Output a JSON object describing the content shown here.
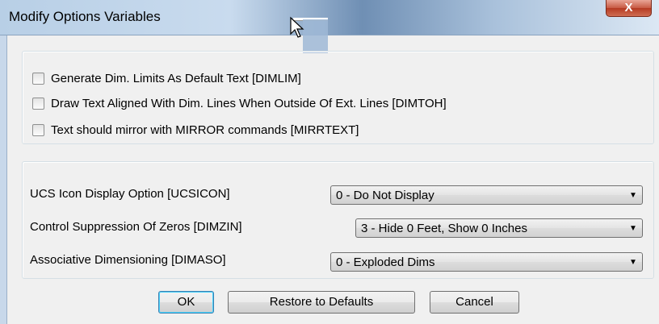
{
  "window": {
    "title": "Modify Options Variables",
    "close_label": "X"
  },
  "checkboxes": [
    {
      "label": "Generate Dim. Limits As Default Text [DIMLIM]",
      "checked": false
    },
    {
      "label": "Draw Text Aligned With Dim. Lines When Outside Of Ext. Lines [DIMTOH]",
      "checked": false
    },
    {
      "label": "Text should mirror with MIRROR commands [MIRRTEXT]",
      "checked": false
    }
  ],
  "options": [
    {
      "label": "UCS Icon Display Option [UCSICON]",
      "value": "0 - Do Not Display"
    },
    {
      "label": "Control Suppression Of Zeros [DIMZIN]",
      "value": "3 - Hide 0 Feet, Show 0 Inches"
    },
    {
      "label": "Associative Dimensioning [DIMASO]",
      "value": "0 - Exploded Dims"
    }
  ],
  "buttons": {
    "ok": "OK",
    "restore": "Restore to Defaults",
    "cancel": "Cancel"
  },
  "icons": {
    "dropdown": "chevron-down-icon",
    "cursor": "mouse-pointer-icon"
  }
}
